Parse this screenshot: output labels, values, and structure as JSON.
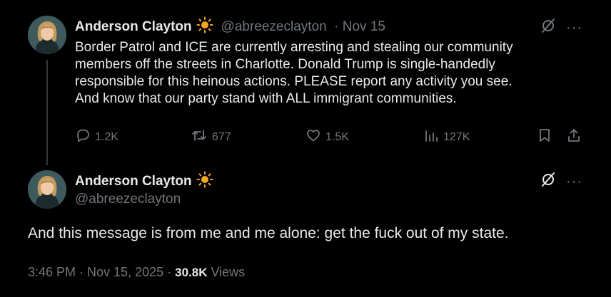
{
  "thread": {
    "tweet1": {
      "author_name": "Anderson Clayton",
      "author_handle": "@abreezeclayton",
      "date": "· Nov 15",
      "text": "Border Patrol and ICE are currently arresting and stealing our community\nmembers off the streets in Charlotte. Donald Trump is single-handedly\nresponsible for this heinous actions. PLEASE report any activity you see.\nAnd know that our party stand with ALL immigrant communities.",
      "replies": "1.2K",
      "reposts": "677",
      "likes": "1.5K",
      "views": "127K"
    },
    "tweet2": {
      "author_name": "Anderson Clayton",
      "author_handle": "@abreezeclayton",
      "text": "And this message is from me and me alone: get the fuck out of my state.",
      "time": "3:46 PM · Nov 15, 2025 · ",
      "view_count": "30.8K",
      "views_label": " Views"
    }
  },
  "colors": {
    "background": "#000000",
    "text": "#e7e9ea",
    "muted": "#71767b",
    "thread_line": "#333639",
    "sun_emoji": "#f5a623"
  },
  "icons": {
    "author_badge": "sun-emoji-icon",
    "top_right": [
      "grok-icon",
      "more-icon"
    ],
    "actions": [
      "reply-icon",
      "repost-icon",
      "like-icon",
      "views-icon",
      "bookmark-icon",
      "share-icon"
    ]
  },
  "more_glyph": "···"
}
